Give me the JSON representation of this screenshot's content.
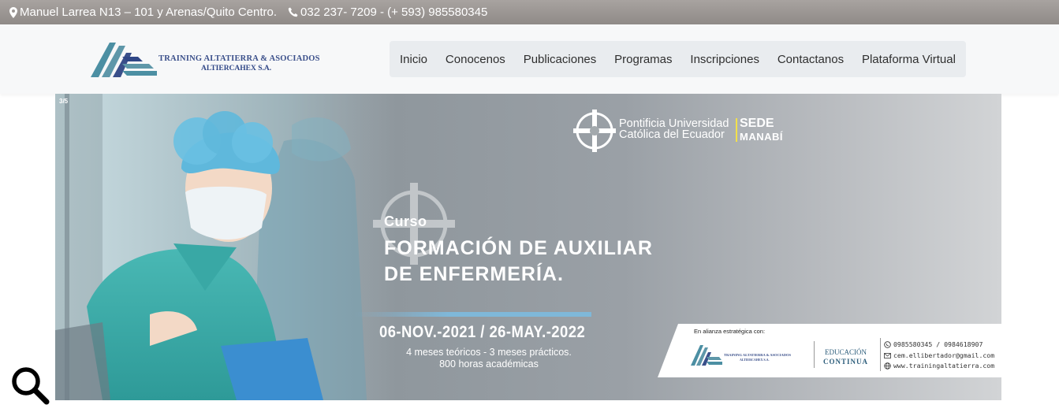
{
  "topbar": {
    "address": "Manuel Larrea N13 – 101 y Arenas/Quito Centro.",
    "phone": "032 237- 7209 - (+ 593) 985580345",
    "icons": [
      "map-marker-icon",
      "phone-icon"
    ]
  },
  "header": {
    "logo": {
      "line1": "TRAINING ALTATIERRA & ASOCIADOS",
      "line2": "ALTIERCAHEX S.A."
    },
    "nav": [
      {
        "label": "Inicio"
      },
      {
        "label": "Conocenos"
      },
      {
        "label": "Publicaciones"
      },
      {
        "label": "Programas"
      },
      {
        "label": "Inscripciones"
      },
      {
        "label": "Contactanos"
      },
      {
        "label": "Plataforma Virtual"
      }
    ]
  },
  "slider": {
    "counter": "3/5",
    "university": {
      "line1": "Pontificia Universidad",
      "line2": "Católica del Ecuador",
      "sede": "SEDE",
      "campus": "MANABÍ"
    },
    "course": {
      "kicker": "Curso",
      "title_line1": "FORMACIÓN DE AUXILIAR",
      "title_line2": "DE ENFERMERÍA.",
      "dates": "06-NOV.-2021 / 26-MAY.-2022",
      "detail_line1": "4 meses teóricos - 3 meses prácticos.",
      "detail_line2": "800 horas académicas"
    },
    "alliance": {
      "label": "En alianza estratégica con:",
      "logo_line1": "TRAINING ALTATIERRA & ASOCIADOS",
      "logo_line2": "ALTIERCAHEX S.A.",
      "edu_line1": "EDUCACIÓN",
      "edu_line2": "CONTINUA",
      "phones": "0985580345 / 0984618907",
      "email": "cem.ellibertador@gmail.com",
      "web": "www.trainingaltatierra.com"
    }
  },
  "colors": {
    "topbar": "#9a9592",
    "header_bg": "#f7f8f9",
    "nav_bg": "#e9ecef",
    "logo_blue": "#3a4f8a",
    "logo_teal": "#4c8fa3",
    "accent_yellow": "#f2e04a"
  },
  "search": {
    "icon": "search-icon"
  }
}
